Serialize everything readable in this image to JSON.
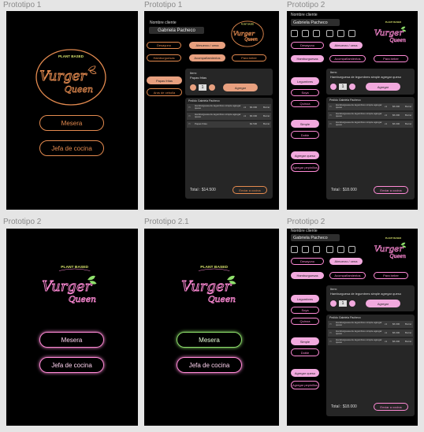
{
  "frames": [
    {
      "label": "Prototipo 1"
    },
    {
      "label": "Prototipo 1"
    },
    {
      "label": "Prototipo 2"
    },
    {
      "label": "Prototipo 2"
    },
    {
      "label": "Prototipo 2.1"
    },
    {
      "label": "Prototipo 2"
    }
  ],
  "logo": {
    "top_text": "PLANT BASED",
    "line1": "Vurger",
    "line2": "Queen"
  },
  "home": {
    "mesera": "Mesera",
    "jefa": "Jefa de cocina"
  },
  "pos": {
    "client_label": "Nombre cliente",
    "client_name": "Gabriela Pacheco",
    "categories": [
      "Desayuno",
      "Almuerzo / cena",
      "Hamburguesas",
      "Acompañamientos",
      "Para beber"
    ],
    "v1_side": [
      "Papas fritas",
      "Aros de cebolla"
    ],
    "v2_side": [
      "Legumbres",
      "Soya",
      "Quinoa",
      "Simple",
      "Doble",
      "Agregar queso",
      "Agregar pepinillos"
    ],
    "item_label": "Item:",
    "v1_item": "Papas fritas",
    "v2_item": "Hamburguesa de legumbres simple agregar queso",
    "qty": "1",
    "add": "Agregar",
    "order_title": "Pedido Gabriela Pacheco",
    "v1_rows": [
      {
        "name": "Hamburguesa de legumbres simple agregar queso",
        "qty": "x1",
        "price": "$6.000",
        "del": "Borrar"
      },
      {
        "name": "Hamburguesa de legumbres simple agregar queso",
        "qty": "x1",
        "price": "$6.000",
        "del": "Borrar"
      },
      {
        "name": "Papas fritas",
        "qty": "",
        "price": "$2.500",
        "del": "Borrar"
      }
    ],
    "v2_rows": [
      {
        "name": "Hamburguesa de legumbres simple agregar queso",
        "qty": "x1",
        "price": "$6.000",
        "del": "Borrar"
      },
      {
        "name": "Hamburguesa de legumbres simple agregar queso",
        "qty": "x1",
        "price": "$6.000",
        "del": "Borrar"
      },
      {
        "name": "Hamburguesa de legumbres simple agregar queso",
        "qty": "x1",
        "price": "$6.000",
        "del": "Borrar"
      }
    ],
    "v1_total": "Total : $14.500",
    "v2_total": "Total : $18.000",
    "send": "Enviar a cocina"
  },
  "colors": {
    "neon_orange": "#e38a4f",
    "peach": "#e8a07f",
    "neon_pink": "#ff8ad6",
    "pink_fill": "#f2a9de",
    "neon_green": "#8fe06c",
    "panel": "#262626",
    "canvas": "#e5e5e5"
  }
}
